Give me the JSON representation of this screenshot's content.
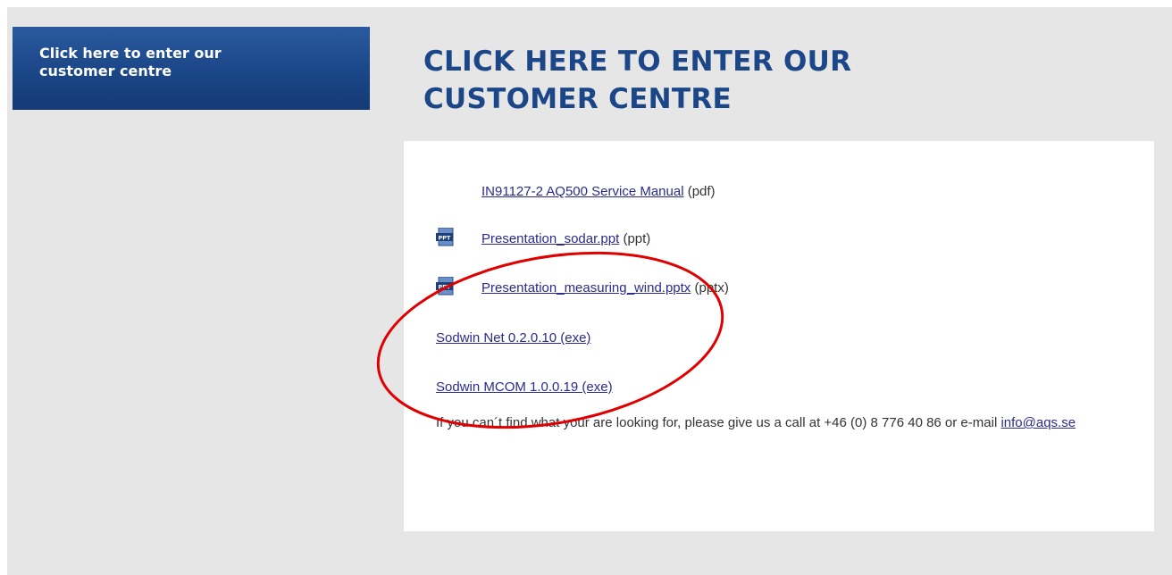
{
  "sidebar": {
    "button_line1": "Click here to enter our",
    "button_line2": "customer centre"
  },
  "header": {
    "title_line1": "CLICK HERE TO ENTER OUR",
    "title_line2": "CUSTOMER CENTRE"
  },
  "files": [
    {
      "name": "IN91127-2 AQ500 Service Manual",
      "type": "(pdf)",
      "icon": null
    },
    {
      "name": "Presentation_sodar.ppt",
      "type": "(ppt)",
      "icon": "ppt-file-icon"
    },
    {
      "name": "Presentation_measuring_wind.pptx",
      "type": "(pptx)",
      "icon": "ppt-file-icon"
    },
    {
      "name": "Sodwin Net 0.2.0.10 (exe)",
      "type": "",
      "icon": null
    },
    {
      "name": "Sodwin MCOM 1.0.0.19 (exe)",
      "type": "",
      "icon": null
    }
  ],
  "icon_label": "PPT",
  "help": {
    "text": "If you can´t find what your are looking for, please give us a call at +46 (0) 8 776 40 86 or e-mail ",
    "email": "info@aqs.se"
  },
  "colors": {
    "brand_blue": "#1b4687",
    "link": "#2b2b8f",
    "annotation_circle": "#e00000",
    "background": "#e6e6e6"
  }
}
